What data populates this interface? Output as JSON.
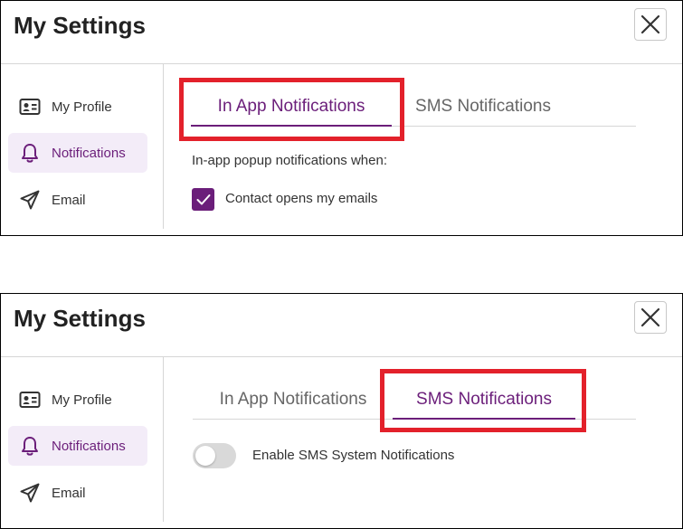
{
  "colors": {
    "accent": "#6b1e7a",
    "active_nav_bg": "#f3ecf8",
    "highlight_border": "#e3212b",
    "toggle_off": "#d9d9d9"
  },
  "panels": [
    {
      "title": "My Settings",
      "close_icon": "close-icon",
      "sidebar": {
        "items": [
          {
            "label": "My Profile",
            "icon": "id-card-icon",
            "active": false
          },
          {
            "label": "Notifications",
            "icon": "bell-icon",
            "active": true
          },
          {
            "label": "Email",
            "icon": "send-icon",
            "active": false
          }
        ]
      },
      "tabs": [
        {
          "label": "In App Notifications",
          "active": true,
          "highlighted": true
        },
        {
          "label": "SMS Notifications",
          "active": false,
          "highlighted": false
        }
      ],
      "content": {
        "section_label": "In-app popup notifications when:",
        "checkbox_label": "Contact opens my emails",
        "checkbox_checked": true
      }
    },
    {
      "title": "My Settings",
      "close_icon": "close-icon",
      "sidebar": {
        "items": [
          {
            "label": "My Profile",
            "icon": "id-card-icon",
            "active": false
          },
          {
            "label": "Notifications",
            "icon": "bell-icon",
            "active": true
          },
          {
            "label": "Email",
            "icon": "send-icon",
            "active": false
          }
        ]
      },
      "tabs": [
        {
          "label": "In App Notifications",
          "active": false,
          "highlighted": false
        },
        {
          "label": "SMS Notifications",
          "active": true,
          "highlighted": true
        }
      ],
      "content": {
        "toggle_label": "Enable SMS System Notifications",
        "toggle_on": false
      }
    }
  ]
}
